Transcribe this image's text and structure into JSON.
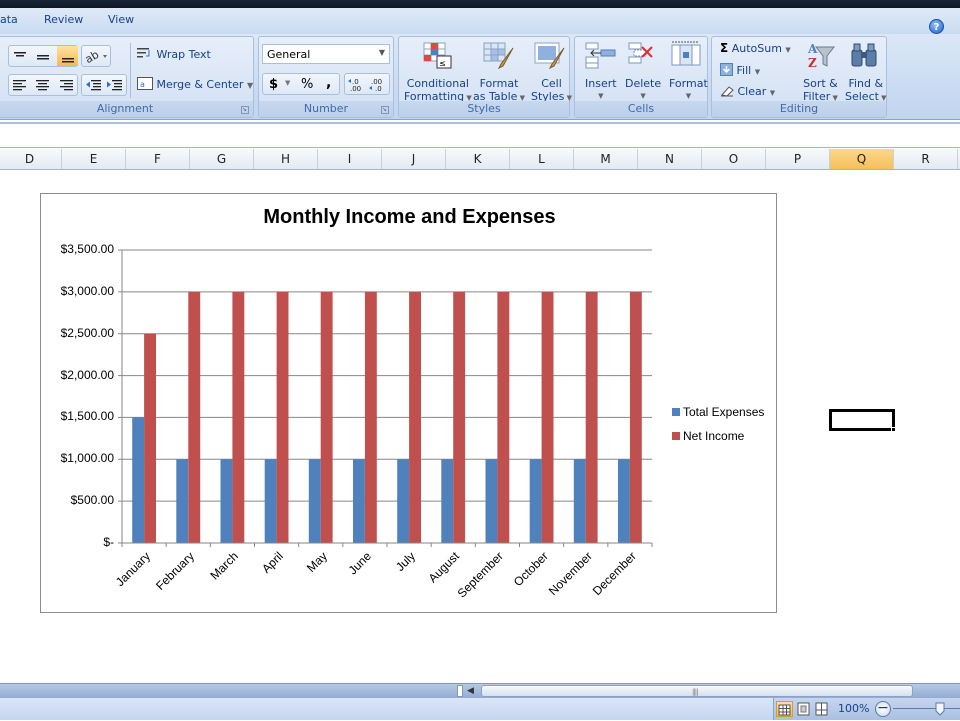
{
  "ribbon": {
    "tabs": [
      "ata",
      "Review",
      "View"
    ],
    "help_icon": "help-icon",
    "groups": {
      "alignment": {
        "label": "Alignment",
        "wrap_text": "Wrap Text",
        "merge_center": "Merge & Center",
        "active_align": "bottom-align"
      },
      "number": {
        "label": "Number",
        "format_value": "General",
        "currency": "$",
        "percent": "%",
        "comma": ",",
        "increase_decimal": "+.0 .00",
        "decrease_decimal": ".00 +.0"
      },
      "styles": {
        "label": "Styles",
        "conditional_formatting": [
          "Conditional",
          "Formatting"
        ],
        "format_as_table": [
          "Format",
          "as Table"
        ],
        "cell_styles": [
          "Cell",
          "Styles"
        ]
      },
      "cells": {
        "label": "Cells",
        "insert": "Insert",
        "delete": "Delete",
        "format": "Format"
      },
      "editing": {
        "label": "Editing",
        "autosum": "AutoSum",
        "fill": "Fill",
        "clear": "Clear",
        "sort_filter": [
          "Sort &",
          "Filter"
        ],
        "find_select": [
          "Find &",
          "Select"
        ]
      }
    }
  },
  "sheet": {
    "columns": [
      "D",
      "E",
      "F",
      "G",
      "H",
      "I",
      "J",
      "K",
      "L",
      "M",
      "N",
      "O",
      "P",
      "Q",
      "R"
    ],
    "selected_column": "Q"
  },
  "status_bar": {
    "zoom": "100%"
  },
  "chart_data": {
    "type": "bar",
    "title": "Monthly Income and Expenses",
    "xlabel": "",
    "ylabel": "",
    "categories": [
      "January",
      "February",
      "March",
      "April",
      "May",
      "June",
      "July",
      "August",
      "September",
      "October",
      "November",
      "December"
    ],
    "series": [
      {
        "name": "Total Expenses",
        "color": "#4f81bd",
        "values": [
          1500,
          1000,
          1000,
          1000,
          1000,
          1000,
          1000,
          1000,
          1000,
          1000,
          1000,
          1000
        ]
      },
      {
        "name": "Net Income",
        "color": "#c0504d",
        "values": [
          2500,
          3000,
          3000,
          3000,
          3000,
          3000,
          3000,
          3000,
          3000,
          3000,
          3000,
          3000
        ]
      }
    ],
    "ylim": [
      0,
      3500
    ],
    "yticks": [
      0,
      500,
      1000,
      1500,
      2000,
      2500,
      3000,
      3500
    ],
    "ytick_labels": [
      "$-",
      "$500.00",
      "$1,000.00",
      "$1,500.00",
      "$2,000.00",
      "$2,500.00",
      "$3,000.00",
      "$3,500.00"
    ],
    "grid": true,
    "legend": "right"
  }
}
